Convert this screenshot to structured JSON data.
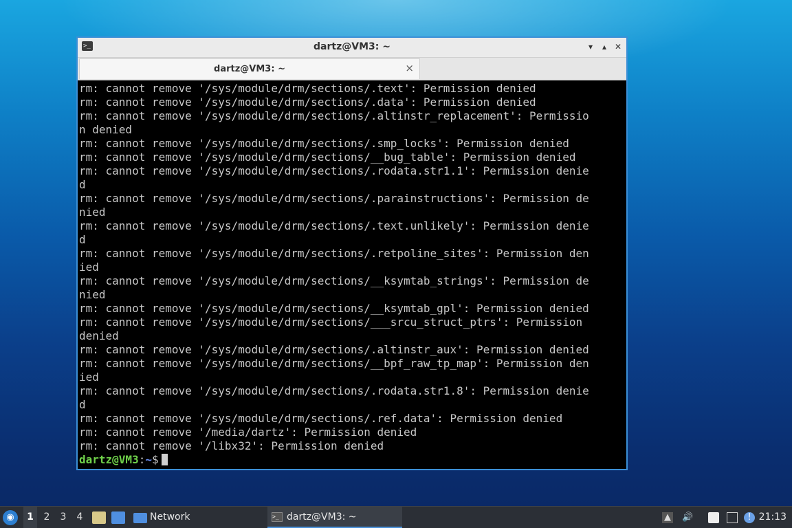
{
  "window": {
    "title": "dartz@VM3: ~",
    "tab_label": "dartz@VM3: ~",
    "tab_close": "×",
    "btn_minimize": "▾",
    "btn_maximize": "▴",
    "btn_close": "✕"
  },
  "terminal": {
    "lines": [
      "rm: cannot remove '/sys/module/drm/sections/.text': Permission denied",
      "rm: cannot remove '/sys/module/drm/sections/.data': Permission denied",
      "rm: cannot remove '/sys/module/drm/sections/.altinstr_replacement': Permissio",
      "n denied",
      "rm: cannot remove '/sys/module/drm/sections/.smp_locks': Permission denied",
      "rm: cannot remove '/sys/module/drm/sections/__bug_table': Permission denied",
      "rm: cannot remove '/sys/module/drm/sections/.rodata.str1.1': Permission denie",
      "d",
      "rm: cannot remove '/sys/module/drm/sections/.parainstructions': Permission de",
      "nied",
      "rm: cannot remove '/sys/module/drm/sections/.text.unlikely': Permission denie",
      "d",
      "rm: cannot remove '/sys/module/drm/sections/.retpoline_sites': Permission den",
      "ied",
      "rm: cannot remove '/sys/module/drm/sections/__ksymtab_strings': Permission de",
      "nied",
      "rm: cannot remove '/sys/module/drm/sections/__ksymtab_gpl': Permission denied",
      "rm: cannot remove '/sys/module/drm/sections/___srcu_struct_ptrs': Permission",
      "denied",
      "rm: cannot remove '/sys/module/drm/sections/.altinstr_aux': Permission denied",
      "rm: cannot remove '/sys/module/drm/sections/__bpf_raw_tp_map': Permission den",
      "ied",
      "rm: cannot remove '/sys/module/drm/sections/.rodata.str1.8': Permission denie",
      "d",
      "rm: cannot remove '/sys/module/drm/sections/.ref.data': Permission denied",
      "rm: cannot remove '/media/dartz': Permission denied",
      "rm: cannot remove '/libx32': Permission denied"
    ],
    "prompt_user": "dartz@VM3",
    "prompt_sep": ":",
    "prompt_path": "~",
    "prompt_symbol": "$"
  },
  "taskbar": {
    "workspaces": [
      "1",
      "2",
      "3",
      "4"
    ],
    "active_workspace": "1",
    "network_label": "Network",
    "terminal_task_label": "dartz@VM3: ~",
    "clock": "21:13"
  },
  "colors": {
    "accent": "#3b8fd6",
    "prompt_user": "#6fd04a",
    "prompt_path": "#6a8ff2",
    "terminal_text": "#c7c7c7"
  },
  "icons": {
    "start": "start-menu-icon",
    "file_manager": "file-manager-icon",
    "desktop": "show-desktop-icon",
    "folder": "folder-icon",
    "terminal": "terminal-icon",
    "volume": "volume-icon",
    "clipboard": "clipboard-icon",
    "network": "network-icon",
    "updates": "updates-icon",
    "arrow_up": "tray-arrow-up-icon"
  }
}
